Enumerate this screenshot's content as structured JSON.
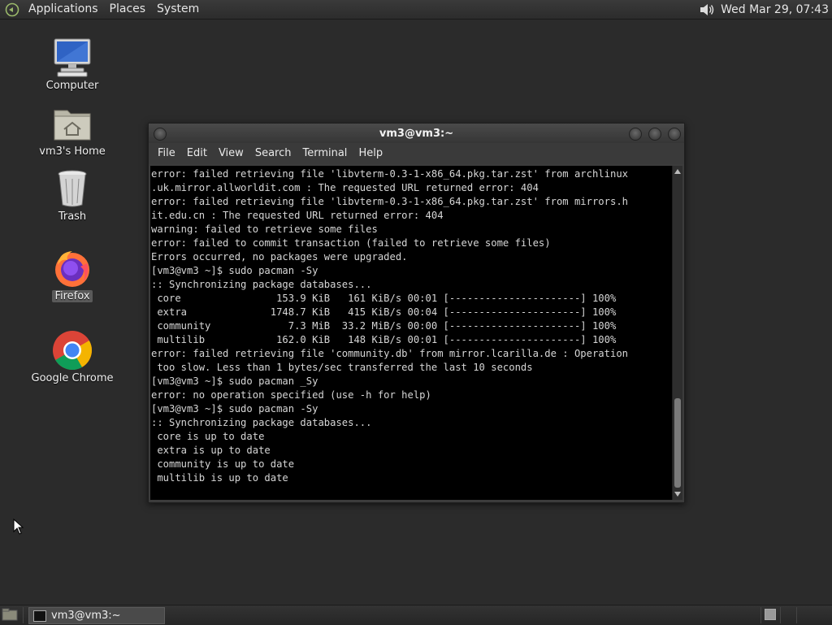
{
  "top_panel": {
    "menus": [
      "Applications",
      "Places",
      "System"
    ],
    "clock": "Wed Mar 29, 07:43",
    "volume_icon": "speaker-icon"
  },
  "desktop_icons": [
    {
      "label": "Computer",
      "icon": "computer-icon"
    },
    {
      "label": "vm3's Home",
      "icon": "home-folder-icon"
    },
    {
      "label": "Trash",
      "icon": "trash-icon"
    },
    {
      "label": "Firefox",
      "icon": "firefox-icon",
      "selected": true
    },
    {
      "label": "Google Chrome",
      "icon": "chrome-icon"
    }
  ],
  "terminal": {
    "title": "vm3@vm3:~",
    "menu": [
      "File",
      "Edit",
      "View",
      "Search",
      "Terminal",
      "Help"
    ],
    "lines": [
      "error: failed retrieving file 'libvterm-0.3-1-x86_64.pkg.tar.zst' from archlinux",
      ".uk.mirror.allworldit.com : The requested URL returned error: 404",
      "error: failed retrieving file 'libvterm-0.3-1-x86_64.pkg.tar.zst' from mirrors.h",
      "it.edu.cn : The requested URL returned error: 404",
      "warning: failed to retrieve some files",
      "error: failed to commit transaction (failed to retrieve some files)",
      "Errors occurred, no packages were upgraded.",
      "[vm3@vm3 ~]$ sudo pacman -Sy",
      ":: Synchronizing package databases...",
      " core                153.9 KiB   161 KiB/s 00:01 [----------------------] 100%",
      " extra              1748.7 KiB   415 KiB/s 00:04 [----------------------] 100%",
      " community             7.3 MiB  33.2 MiB/s 00:00 [----------------------] 100%",
      " multilib            162.0 KiB   148 KiB/s 00:01 [----------------------] 100%",
      "error: failed retrieving file 'community.db' from mirror.lcarilla.de : Operation",
      " too slow. Less than 1 bytes/sec transferred the last 10 seconds",
      "[vm3@vm3 ~]$ sudo pacman _Sy",
      "error: no operation specified (use -h for help)",
      "[vm3@vm3 ~]$ sudo pacman -Sy",
      ":: Synchronizing package databases...",
      " core is up to date",
      " extra is up to date",
      " community is up to date",
      " multilib is up to date"
    ]
  },
  "taskbar": {
    "items": [
      {
        "label": "vm3@vm3:~",
        "icon": "terminal-icon"
      }
    ]
  },
  "colors": {
    "desktop_bg": "#2b2b2b",
    "terminal_bg": "#000000",
    "terminal_fg": "#d6d6d6"
  }
}
